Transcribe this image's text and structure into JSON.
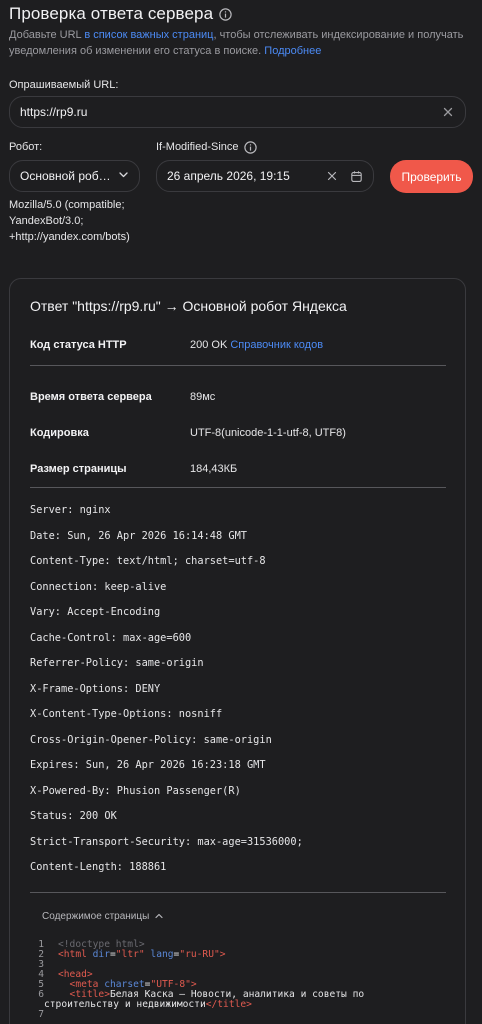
{
  "header": {
    "title": "Проверка ответа сервера",
    "desc_pre": "Добавьте URL ",
    "desc_link": "в список важных страниц",
    "desc_mid": ", чтобы отслеживать индексирование и получать уведомления об изменении его статуса в поиске. ",
    "desc_more": "Подробнее"
  },
  "form": {
    "url_label": "Опрашиваемый URL:",
    "url_value": "https://rp9.ru",
    "robot_label": "Робот:",
    "robot_value": "Основной роб…",
    "ims_label": "If-Modified-Since",
    "ims_value": "26 апрель 2026, 19:15",
    "check_button": "Проверить",
    "user_agent": "Mozilla/5.0 (compatible; YandexBot/3.0; +http://yandex.com/bots)"
  },
  "result": {
    "title": "Ответ \"https://rp9.ru\" → Основной робот Яндекса",
    "status_label": "Код статуса HTTP",
    "status_value": "200 OK",
    "status_link": "Справочник кодов",
    "time_label": "Время ответа сервера",
    "time_value": "89мс",
    "encoding_label": "Кодировка",
    "encoding_value": "UTF-8(unicode-1-1-utf-8, UTF8)",
    "size_label": "Размер страницы",
    "size_value": "184,43КБ",
    "headers": [
      "Server: nginx",
      "Date: Sun, 26 Apr 2026 16:14:48 GMT",
      "Content-Type: text/html; charset=utf-8",
      "Connection: keep-alive",
      "Vary: Accept-Encoding",
      "Cache-Control: max-age=600",
      "Referrer-Policy: same-origin",
      "X-Frame-Options: DENY",
      "X-Content-Type-Options: nosniff",
      "Cross-Origin-Opener-Policy: same-origin",
      "Expires: Sun, 26 Apr 2026 16:23:18 GMT",
      "X-Powered-By: Phusion Passenger(R)",
      "Status: 200 OK",
      "Strict-Transport-Security: max-age=31536000;",
      "Content-Length: 188861"
    ],
    "content_toggle": "Содержимое страницы",
    "code": {
      "line_numbers": [
        "1",
        "2",
        "3",
        "4",
        "5",
        "6",
        "",
        "7"
      ],
      "l1": "<!doctype html>",
      "l2_tag_open": "<html ",
      "l2_attr1": "dir",
      "l2_eq1": "=",
      "l2_val1": "\"ltr\"",
      "l2_attr2": " lang",
      "l2_eq2": "=",
      "l2_val2": "\"ru-RU\"",
      "l2_tag_close": ">",
      "l4": "<head>",
      "l5_tag": "  <meta ",
      "l5_attr": "charset",
      "l5_eq": "=",
      "l5_val": "\"UTF-8\"",
      "l5_close": ">",
      "l6_tag": "  <title>",
      "l6_text": "Белая Каска — Новости, аналитика и советы по",
      "l6b_text": "строительству и недвижимости",
      "l6b_close": "</title>"
    }
  },
  "colors": {
    "background": "#1e1e20",
    "accent_button": "#f0584a",
    "link": "#4c8bf5"
  }
}
